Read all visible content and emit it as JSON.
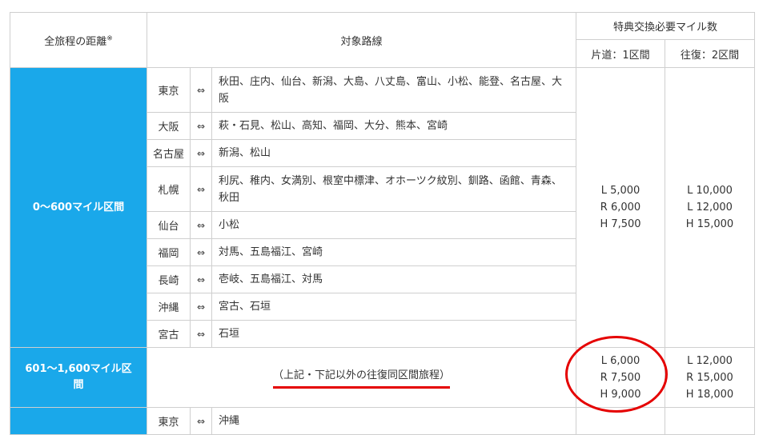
{
  "header": {
    "distance": "全旅程の距離",
    "distance_mark": "※",
    "routes": "対象路線",
    "miles": "特典交換必要マイル数",
    "oneway": "片道：1区間",
    "roundtrip": "往復：2区間"
  },
  "arrow_symbol": "⇔",
  "band1": {
    "label": "0〜600マイル区間",
    "routes": [
      {
        "from": "東京",
        "to": "秋田、庄内、仙台、新潟、大島、八丈島、富山、小松、能登、名古屋、大阪"
      },
      {
        "from": "大阪",
        "to": "萩・石見、松山、高知、福岡、大分、熊本、宮崎"
      },
      {
        "from": "名古屋",
        "to": "新潟、松山"
      },
      {
        "from": "札幌",
        "to": "利尻、稚内、女満別、根室中標津、オホーツク紋別、釧路、函館、青森、秋田"
      },
      {
        "from": "仙台",
        "to": "小松"
      },
      {
        "from": "福岡",
        "to": "対馬、五島福江、宮崎"
      },
      {
        "from": "長崎",
        "to": "壱岐、五島福江、対馬"
      },
      {
        "from": "沖縄",
        "to": "宮古、石垣"
      },
      {
        "from": "宮古",
        "to": "石垣"
      }
    ],
    "oneway": [
      "L 5,000",
      "R 6,000",
      "H 7,500"
    ],
    "roundtrip": [
      "L 10,000",
      "L 12,000",
      "H 15,000"
    ]
  },
  "band2": {
    "label": "601〜1,600マイル区間",
    "note": "（上記・下記以外の往復同区間旅程）",
    "oneway": [
      "L 6,000",
      "R 7,500",
      "H 9,000"
    ],
    "roundtrip": [
      "L 12,000",
      "R 15,000",
      "H 18,000"
    ]
  },
  "band3": {
    "routes": [
      {
        "from": "東京",
        "to": "沖縄"
      }
    ]
  },
  "colors": {
    "band_blue": "#1aa8ea",
    "highlight_red": "#e50000"
  }
}
